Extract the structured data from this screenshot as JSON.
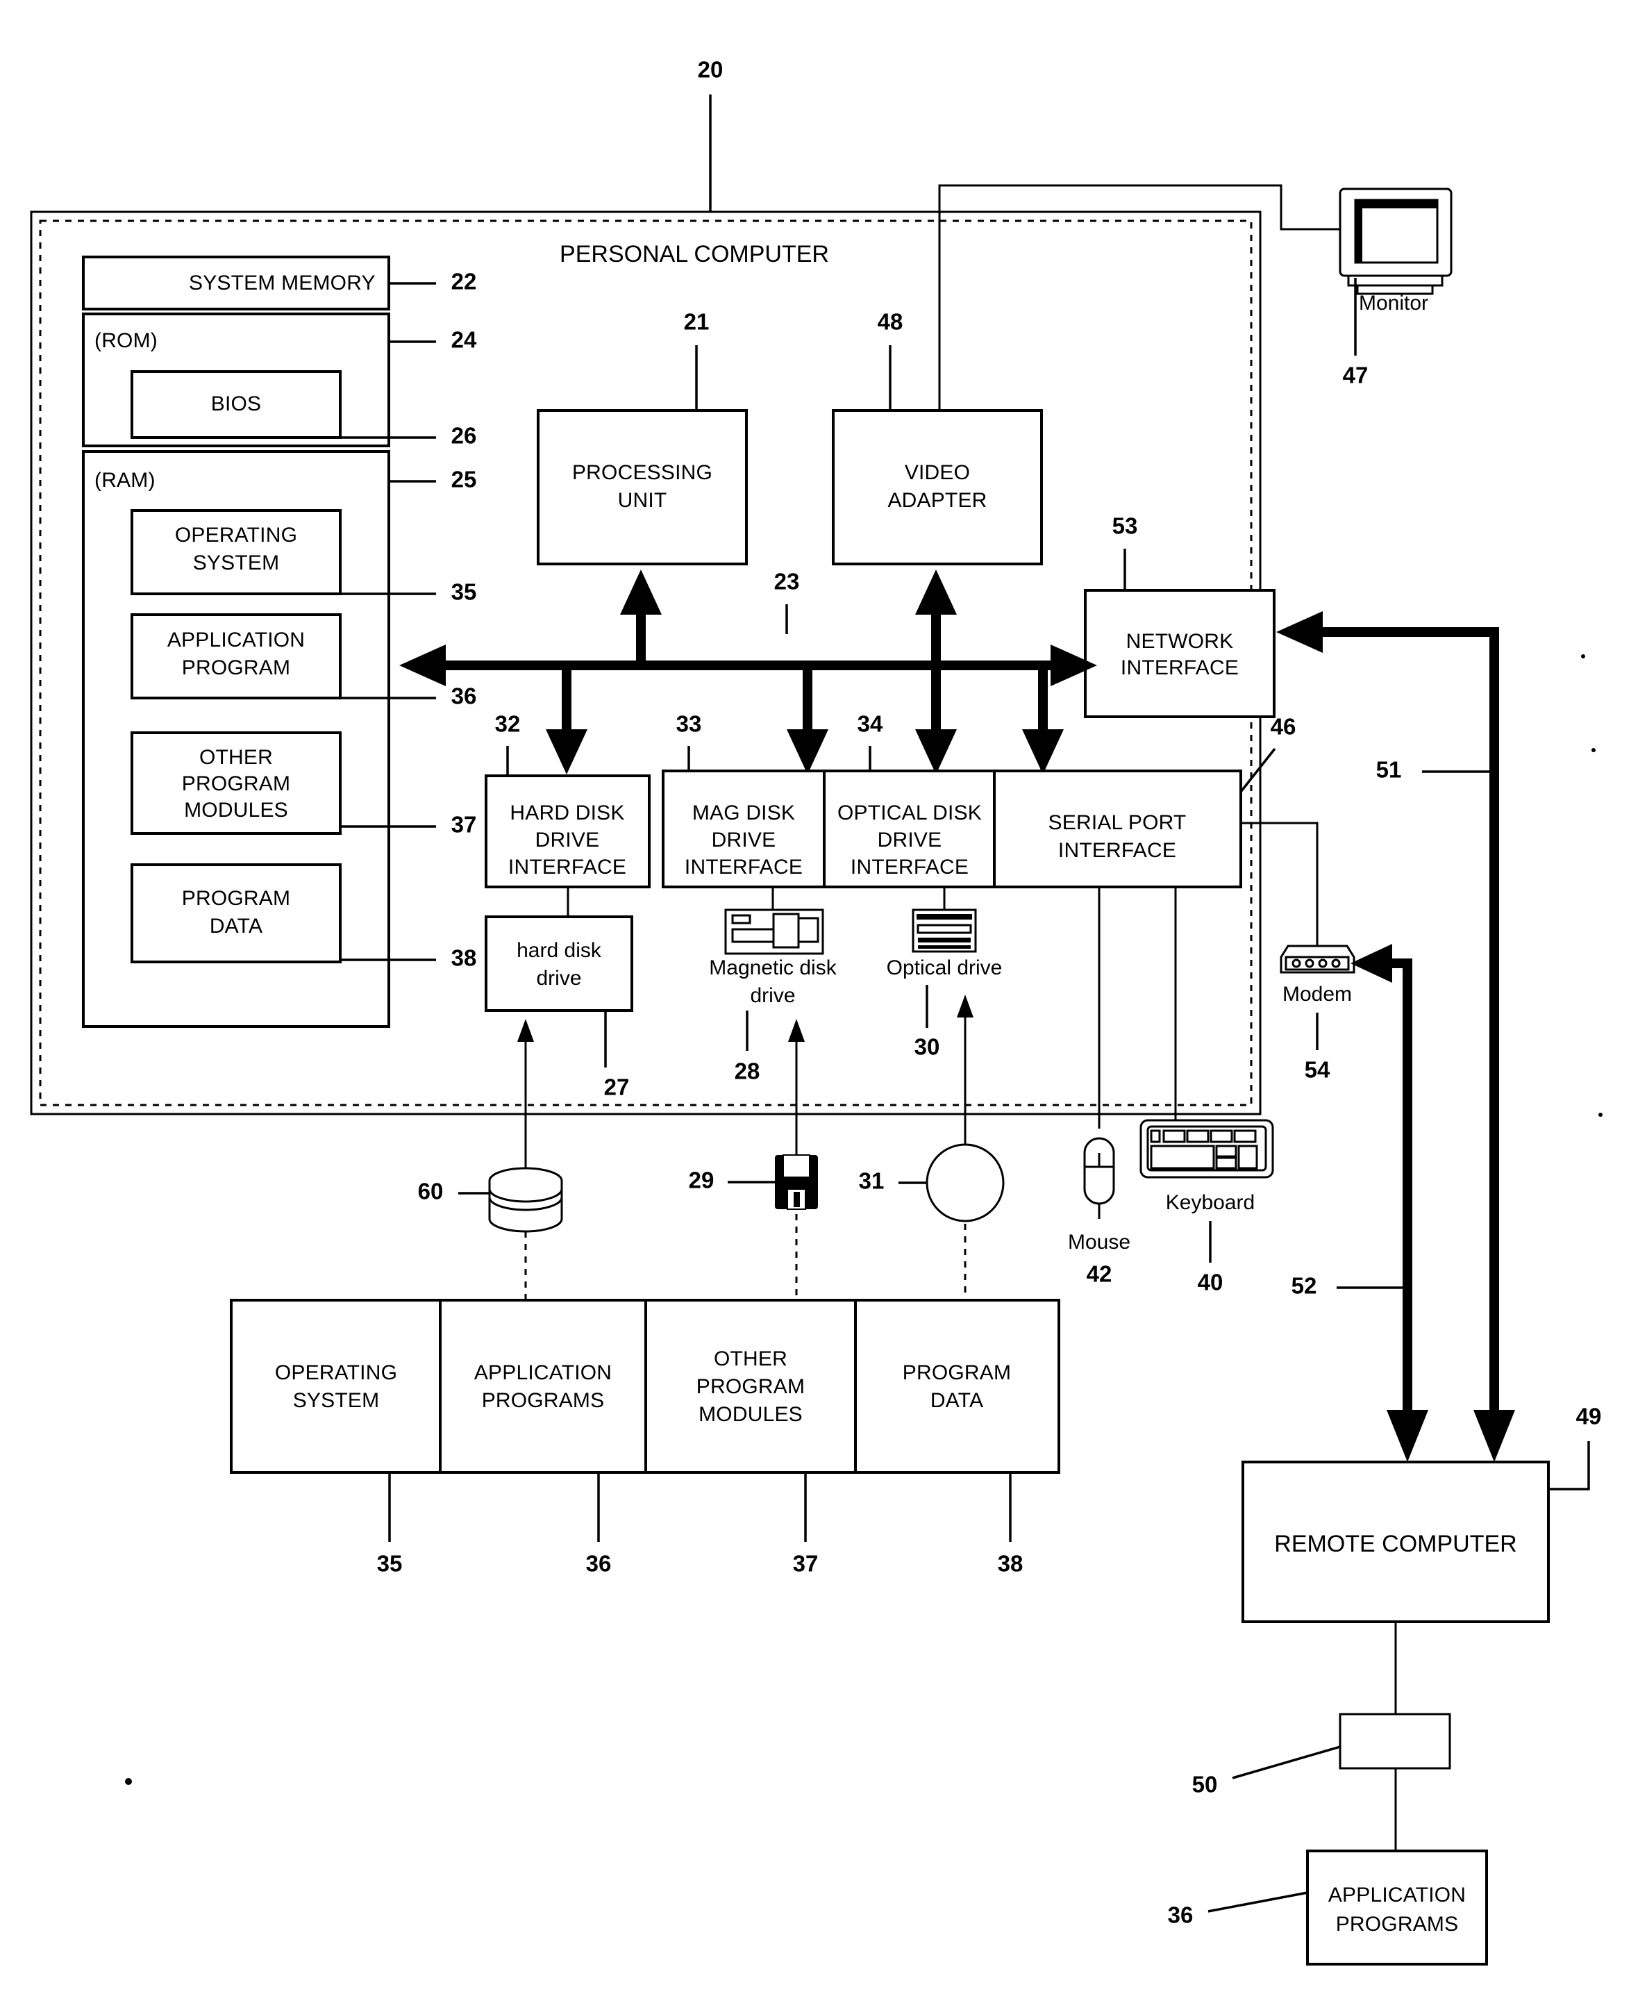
{
  "figure": {
    "title": "PERSONAL COMPUTER",
    "figure_number": "20"
  },
  "memory": {
    "system_memory_label": "SYSTEM MEMORY",
    "system_memory_ref": "22",
    "rom_label": "(ROM)",
    "rom_ref": "24",
    "bios_label": "BIOS",
    "bios_ref": "26",
    "ram_label": "(RAM)",
    "ram_ref": "25",
    "blocks": [
      {
        "label_line1": "OPERATING",
        "label_line2": "SYSTEM",
        "label_line3": "",
        "ref": "35"
      },
      {
        "label_line1": "APPLICATION",
        "label_line2": "PROGRAM",
        "label_line3": "",
        "ref": "36"
      },
      {
        "label_line1": "OTHER",
        "label_line2": "PROGRAM",
        "label_line3": "MODULES",
        "ref": "37"
      },
      {
        "label_line1": "PROGRAM",
        "label_line2": "DATA",
        "label_line3": "",
        "ref": "38"
      }
    ]
  },
  "core": {
    "processing_unit_line1": "PROCESSING",
    "processing_unit_line2": "UNIT",
    "processing_unit_ref": "21",
    "video_adapter_line1": "VIDEO",
    "video_adapter_line2": "ADAPTER",
    "video_adapter_ref": "48",
    "network_interface_line1": "NETWORK",
    "network_interface_line2": "INTERFACE",
    "network_interface_ref": "53",
    "bus_ref": "23"
  },
  "interfaces": [
    {
      "line1": "HARD DISK",
      "line2": "DRIVE",
      "line3": "INTERFACE",
      "ref": "32"
    },
    {
      "line1": "MAG DISK",
      "line2": "DRIVE",
      "line3": "INTERFACE",
      "ref": "33"
    },
    {
      "line1": "OPTICAL DISK",
      "line2": "DRIVE",
      "line3": "INTERFACE",
      "ref": "34"
    },
    {
      "line1": "SERIAL PORT",
      "line2": "INTERFACE",
      "line3": "",
      "ref": "46"
    }
  ],
  "drives": {
    "hard_disk_drive_line1": "hard disk",
    "hard_disk_drive_line2": "drive",
    "hard_disk_drive_ref": "27",
    "magnetic_disk_drive_line1": "Magnetic disk",
    "magnetic_disk_drive_line2": "drive",
    "magnetic_disk_drive_ref": "28",
    "optical_drive_label": "Optical drive",
    "optical_drive_ref": "30",
    "hard_disk_media_ref": "60",
    "floppy_media_ref": "29",
    "optical_media_ref": "31"
  },
  "peripherals": {
    "monitor_label": "Monitor",
    "monitor_ref": "47",
    "mouse_label": "Mouse",
    "mouse_ref": "42",
    "keyboard_label": "Keyboard",
    "keyboard_ref": "40",
    "modem_label": "Modem",
    "modem_ref": "54"
  },
  "storage_media_blocks": [
    {
      "line1": "OPERATING",
      "line2": "SYSTEM",
      "line3": "",
      "ref": "35"
    },
    {
      "line1": "APPLICATION",
      "line2": "PROGRAMS",
      "line3": "",
      "ref": "36"
    },
    {
      "line1": "OTHER",
      "line2": "PROGRAM",
      "line3": "MODULES",
      "ref": "37"
    },
    {
      "line1": "PROGRAM",
      "line2": "DATA",
      "line3": "",
      "ref": "38"
    }
  ],
  "remote": {
    "remote_computer_label": "REMOTE COMPUTER",
    "remote_computer_ref": "49",
    "memory_block_ref": "50",
    "application_programs_line1": "APPLICATION",
    "application_programs_line2": "PROGRAMS",
    "application_programs_ref": "36",
    "wan_ref": "51",
    "lan_ref": "52"
  },
  "colors": {
    "ink": "#000000",
    "paper": "#ffffff"
  }
}
